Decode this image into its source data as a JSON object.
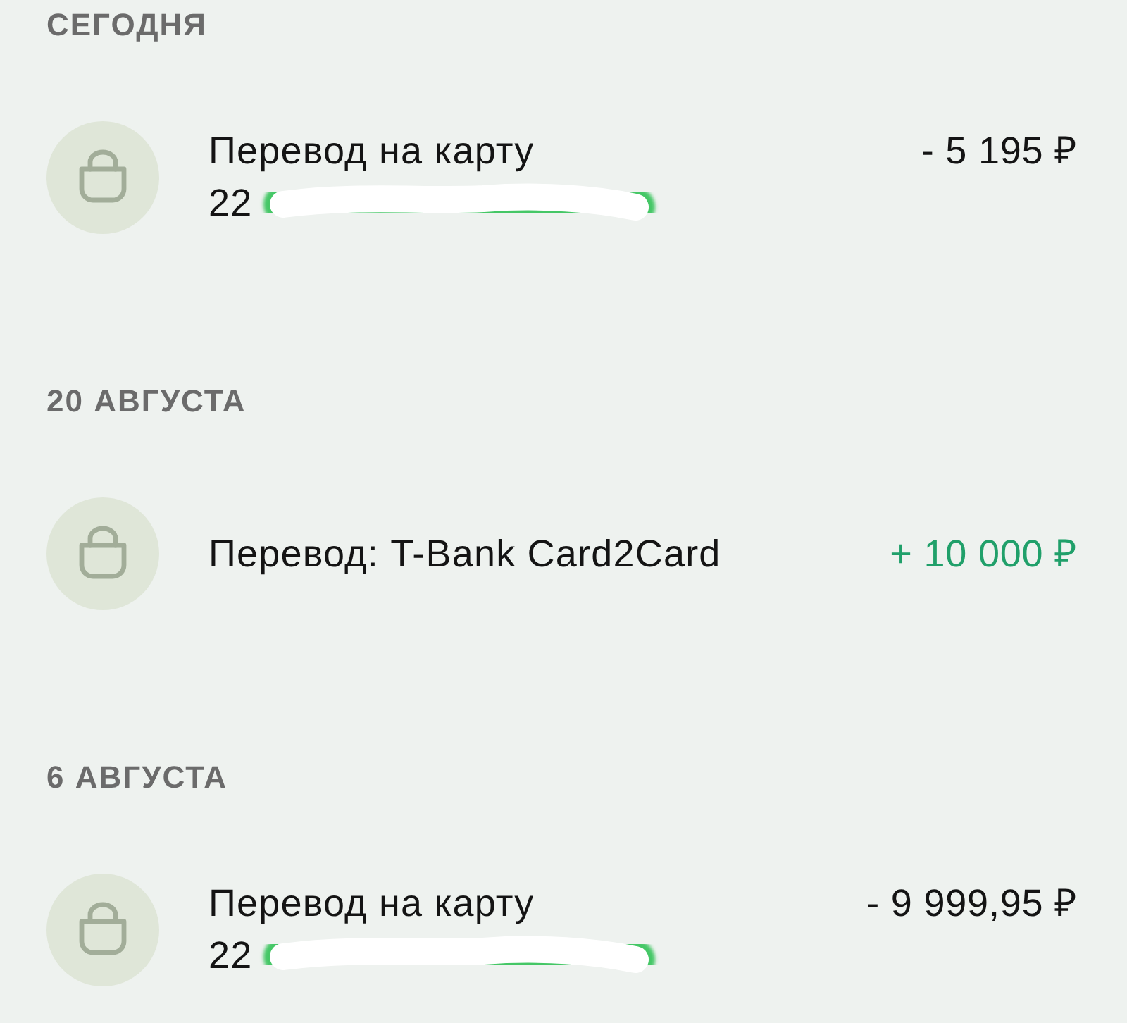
{
  "sections": [
    {
      "header": "СЕГОДНЯ",
      "transactions": [
        {
          "title": "Перевод на карту",
          "subtitle": "22",
          "redacted": true,
          "amount": "- 5 195 ₽",
          "incoming": false
        }
      ]
    },
    {
      "header": "20 АВГУСТА",
      "transactions": [
        {
          "title": "Перевод: T-Bank Card2Card",
          "amount": "+ 10 000 ₽",
          "incoming": true
        }
      ]
    },
    {
      "header": "6 АВГУСТА",
      "transactions": [
        {
          "title": "Перевод на карту",
          "subtitle": "22",
          "redacted": true,
          "amount": "- 9 999,95 ₽",
          "incoming": false
        }
      ]
    }
  ]
}
